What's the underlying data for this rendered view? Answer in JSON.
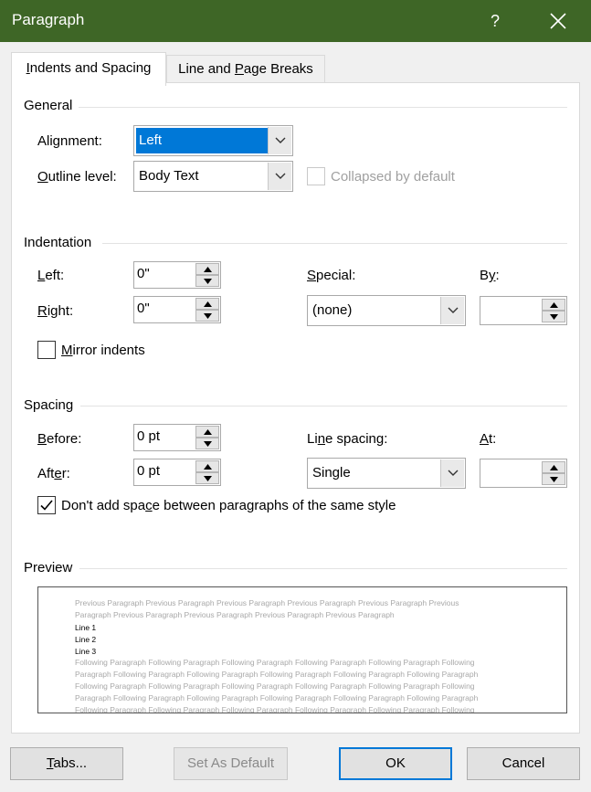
{
  "window": {
    "title": "Paragraph",
    "help_label": "?",
    "titlebar_color": "#3e6626"
  },
  "tabs": [
    {
      "label_pre": "",
      "label_key": "I",
      "label_post": "ndents and Spacing",
      "active": true
    },
    {
      "label_pre": "Line and ",
      "label_key": "P",
      "label_post": "age Breaks",
      "active": false
    }
  ],
  "general": {
    "title": "General",
    "alignment": {
      "label_pre": "Ali",
      "label_key": "g",
      "label_post": "nment:",
      "value": "Left"
    },
    "outline": {
      "label_pre": "",
      "label_key": "O",
      "label_post": "utline level:",
      "value": "Body Text"
    },
    "collapsed": {
      "label": "Collapsed by default",
      "checked": false,
      "enabled": false
    }
  },
  "indentation": {
    "title": "Indentation",
    "left": {
      "label_pre": "",
      "label_key": "L",
      "label_post": "eft:",
      "value": "0\""
    },
    "right": {
      "label_pre": "",
      "label_key": "R",
      "label_post": "ight:",
      "value": "0\""
    },
    "special": {
      "label_pre": "",
      "label_key": "S",
      "label_post": "pecial:",
      "value": "(none)"
    },
    "by": {
      "label_pre": "B",
      "label_key": "y",
      "label_post": ":",
      "value": ""
    },
    "mirror": {
      "label_pre": "",
      "label_key": "M",
      "label_post": "irror indents",
      "checked": false
    }
  },
  "spacing": {
    "title": "Spacing",
    "before": {
      "label_pre": "",
      "label_key": "B",
      "label_post": "efore:",
      "value": "0 pt"
    },
    "after": {
      "label_pre": "Aft",
      "label_key": "e",
      "label_post": "r:",
      "value": "0 pt"
    },
    "line_spacing": {
      "label_pre": "Li",
      "label_key": "n",
      "label_post": "e spacing:",
      "value": "Single"
    },
    "at": {
      "label_pre": "",
      "label_key": "A",
      "label_post": "t:",
      "value": ""
    },
    "dont_add": {
      "label_pre": "Don't add spa",
      "label_key": "c",
      "label_post": "e between paragraphs of the same style",
      "checked": true
    }
  },
  "preview": {
    "title": "Preview",
    "previous": [
      "Previous Paragraph Previous Paragraph Previous Paragraph Previous Paragraph Previous Paragraph Previous",
      "Paragraph Previous Paragraph Previous Paragraph Previous Paragraph Previous Paragraph"
    ],
    "lines": [
      "Line 1",
      "Line 2",
      "Line 3"
    ],
    "following": [
      "Following Paragraph Following Paragraph Following Paragraph Following Paragraph Following Paragraph Following",
      "Paragraph Following Paragraph Following Paragraph Following Paragraph Following Paragraph Following Paragraph",
      "Following Paragraph Following Paragraph Following Paragraph Following Paragraph Following Paragraph Following",
      "Paragraph Following Paragraph Following Paragraph Following Paragraph Following Paragraph Following Paragraph",
      "Following Paragraph Following Paragraph Following Paragraph Following Paragraph Following Paragraph Following"
    ]
  },
  "buttons": {
    "tabs": {
      "label_pre": "",
      "label_key": "T",
      "label_post": "abs..."
    },
    "set_default": "Set As Default",
    "ok": "OK",
    "cancel": "Cancel"
  },
  "colors": {
    "selection": "#0078d7",
    "ok_border": "#0078d7"
  }
}
